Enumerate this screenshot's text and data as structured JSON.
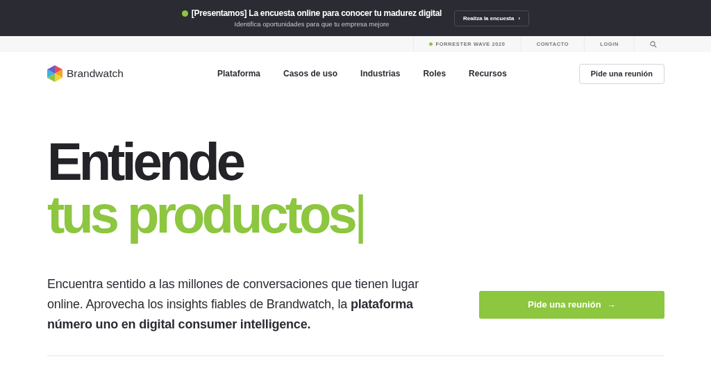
{
  "announcement": {
    "title": "[Presentamos] La encuesta online para conocer tu madurez digital",
    "subtitle": "Identifica oportunidades para que tu empresa mejore",
    "button": "Realiza la encuesta",
    "button_icon": "›"
  },
  "utility_bar": {
    "items": [
      {
        "kind": "dot-link",
        "label": "FORRESTER WAVE 2020"
      },
      {
        "kind": "link",
        "label": "CONTACTO"
      },
      {
        "kind": "link",
        "label": "LOGIN"
      },
      {
        "kind": "search"
      }
    ]
  },
  "nav": {
    "brand": "Brandwatch",
    "items": [
      "Plataforma",
      "Casos de uso",
      "Industrias",
      "Roles",
      "Recursos"
    ],
    "cta": "Pide una reunión"
  },
  "hero": {
    "heading_line1": "Entiende",
    "heading_line2": "tus productos",
    "cursor": "|",
    "description": "Encuentra sentido a las millones de conversaciones que tienen lugar online. Aprovecha los insights fiables de Brandwatch, la **plataforma número uno en digital consumer intelligence.**",
    "cta": "Pide una reunión",
    "cta_icon": "→"
  }
}
